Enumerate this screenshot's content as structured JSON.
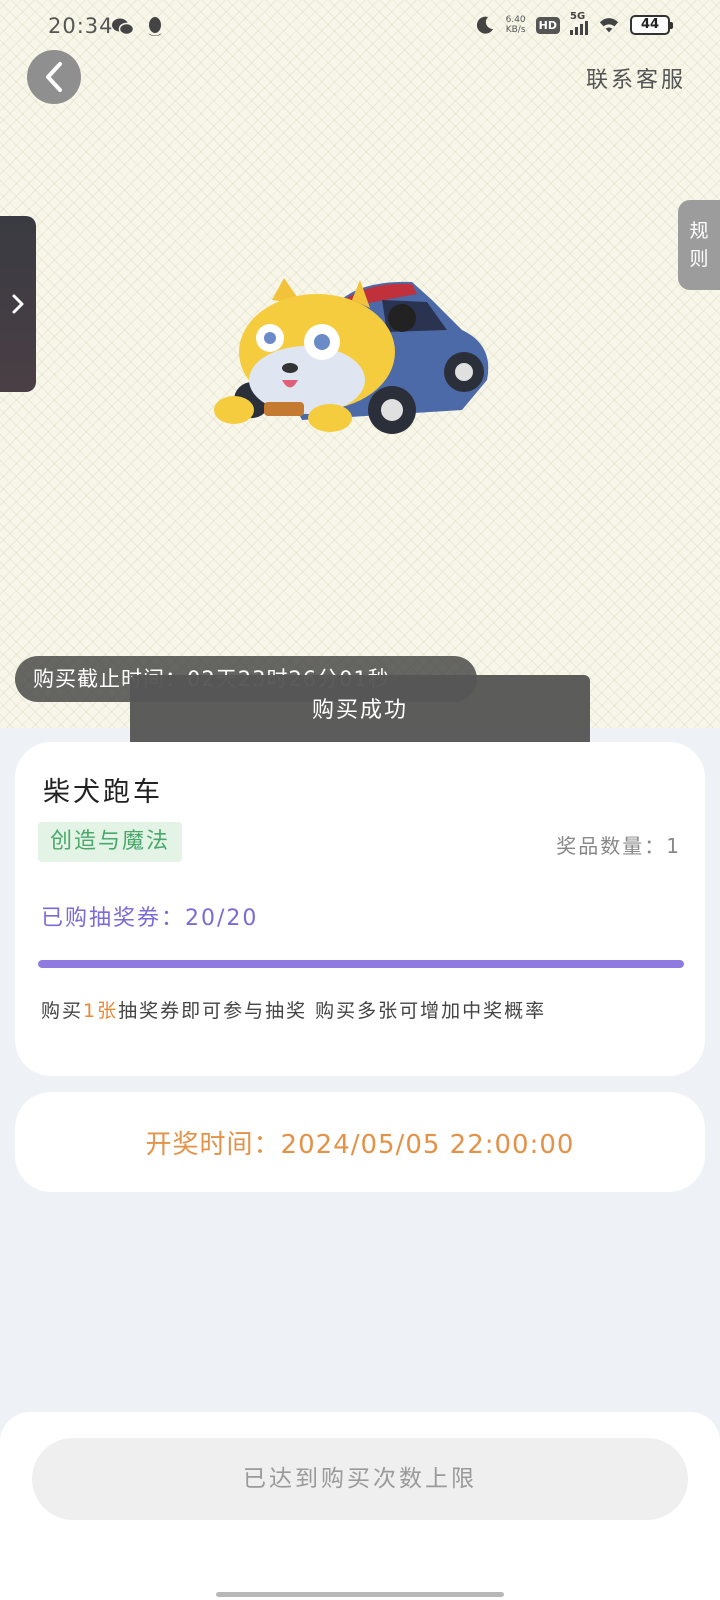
{
  "status_bar": {
    "time": "20:34",
    "net_speed_value": "6.40",
    "net_speed_unit": "KB/s",
    "hd_label": "HD",
    "network_type": "5G",
    "battery": "44"
  },
  "header": {
    "contact_label": "联系客服"
  },
  "rules_tab": {
    "label_line1": "规",
    "label_line2": "则"
  },
  "deadline": {
    "text": "购买截止时间：02天23时26分01秒"
  },
  "toast": {
    "text": "购买成功"
  },
  "prize": {
    "name": "柴犬跑车",
    "category": "创造与魔法",
    "quantity_text": "奖品数量：1",
    "progress_label": "已购抽奖券：",
    "progress_value": "20/20",
    "progress_fraction": 1.0,
    "hint_before": "购买",
    "hint_highlight": "1张",
    "hint_after": "抽奖券即可参与抽奖 购买多张可增加中奖概率"
  },
  "draw": {
    "label": "开奖时间：",
    "time": "2024/05/05 22:00:00"
  },
  "purchase_button": {
    "label": "已达到购买次数上限"
  },
  "colors": {
    "progress": "#8e7ae0",
    "accent_orange": "#e39248",
    "tag_green": "#4aa86a"
  }
}
